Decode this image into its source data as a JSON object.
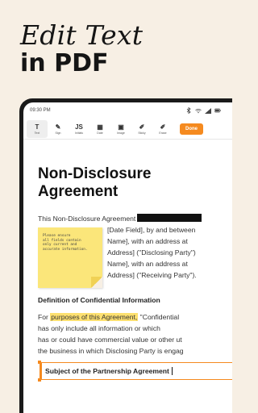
{
  "promo": {
    "line1": "Edit Text",
    "line2": "in PDF"
  },
  "status": {
    "time": "09:30 PM"
  },
  "toolbar": {
    "tools": [
      {
        "name": "text",
        "icon": "T",
        "label": "Text"
      },
      {
        "name": "sign",
        "icon": "✎",
        "label": "Sign"
      },
      {
        "name": "initials",
        "icon": "JS",
        "label": "Initials"
      },
      {
        "name": "date",
        "icon": "▦",
        "label": "Date"
      },
      {
        "name": "image",
        "icon": "▣",
        "label": "Image"
      },
      {
        "name": "sticky",
        "icon": "✐",
        "label": "Sticky"
      },
      {
        "name": "erase",
        "icon": "✐",
        "label": "Erase"
      }
    ],
    "done_label": "Done"
  },
  "document": {
    "title_line1": "Non-Disclosure",
    "title_line2": "Agreement",
    "p1": [
      "This Non-Disclosure Agreement",
      "[Date Field], by and between",
      "Name], with an address at",
      "Address] (\"Disclosing Party\")",
      "Name], with an address at",
      "Address] (\"Receiving Party\")."
    ],
    "section1": "Definition of Confidential Information",
    "p2_start": "For ",
    "p2_highlight": "purposes of this Agreement,",
    "p2_end": " \"Confidential",
    "p2_lines": [
      "has only include all information or which",
      "has or could have commercial value or other ut",
      "the business in which Disclosing Party is engag"
    ],
    "editing_text": "Subject of the Partnership Agreement"
  },
  "sticky_note": {
    "text": "Please ensure\nall fields contain\nonly current and\naccurate information."
  }
}
